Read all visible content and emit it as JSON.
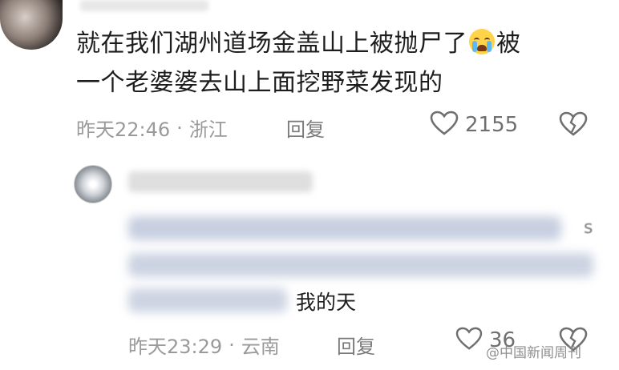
{
  "comment": {
    "line1_before_emoji": "就在我们湖州道场金盖山上被抛尸了",
    "emoji": "loudly-crying-face-emoji",
    "line1_after_emoji": "被",
    "line2": "一个老婆婆去山上面挖野菜发现的",
    "time": "昨天22:46",
    "separator": "·",
    "location": "浙江",
    "reply_label": "回复",
    "likes": "2155"
  },
  "reply": {
    "visible_text": "我的天",
    "partial_edge_char": "s",
    "time": "昨天23:29",
    "separator": "·",
    "location": "云南",
    "reply_label": "回复",
    "likes": "36"
  },
  "watermark": "@中国新闻周刊",
  "colors": {
    "text": "#1d1d1d",
    "meta": "#9a9a9a",
    "blur": "#c7cfe0",
    "emoji": "#ffd34a"
  }
}
